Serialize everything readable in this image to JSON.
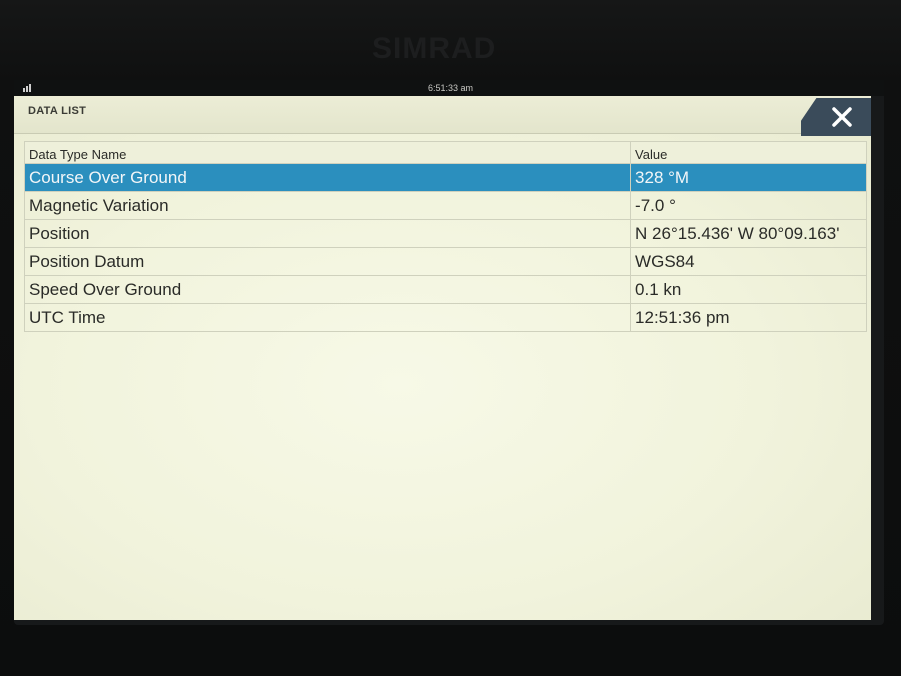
{
  "device": {
    "brand": "SIMRAD"
  },
  "status_bar": {
    "time": "6:51:33 am"
  },
  "window": {
    "title": "DATA LIST",
    "close_icon": "close-x-icon"
  },
  "table": {
    "headers": [
      "Data Type Name",
      "Value"
    ],
    "selected_row": 0,
    "rows": [
      {
        "name": "Course Over Ground",
        "value": "328 °M"
      },
      {
        "name": "Magnetic Variation",
        "value": "-7.0 °"
      },
      {
        "name": "Position",
        "value": "N  26°15.436' W  80°09.163'"
      },
      {
        "name": "Position Datum",
        "value": "WGS84"
      },
      {
        "name": "Speed Over Ground",
        "value": "0.1 kn"
      },
      {
        "name": "UTC Time",
        "value": "12:51:36 pm"
      }
    ]
  },
  "colors": {
    "selection": "#2b8fbe",
    "close_button": "#3a4b5a",
    "panel": "#f1f3dc"
  }
}
